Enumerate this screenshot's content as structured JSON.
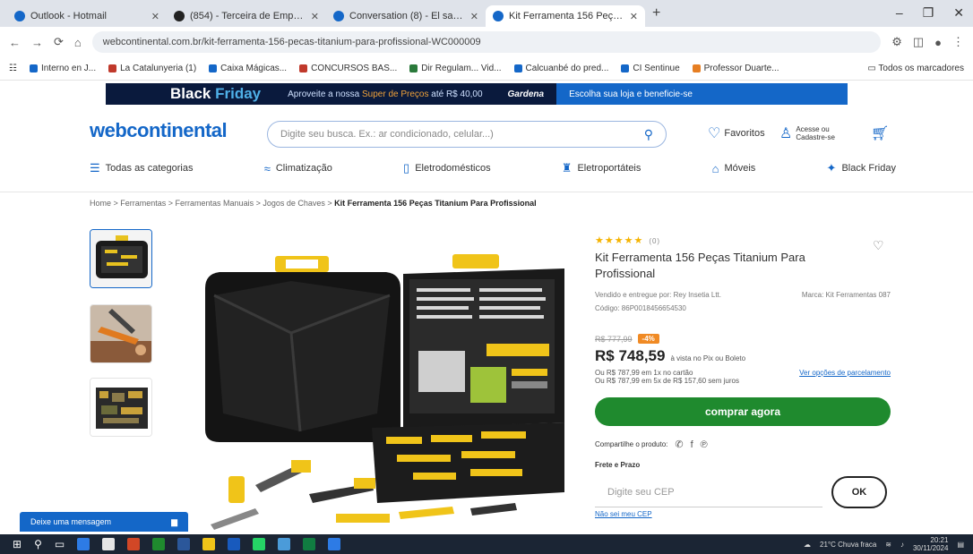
{
  "browser": {
    "tabs": [
      {
        "label": "Outlook - Hotmail",
        "color": "#1467c8"
      },
      {
        "label": "(854) - Terceira de Emprende...",
        "color": "#222"
      },
      {
        "label": "Conversation (8) - El sabiduría...",
        "color": "#1467c8"
      },
      {
        "label": "Kit Ferramenta 156 Peças Titan...",
        "color": "#1467c8",
        "active": true
      }
    ],
    "url": "webcontinental.com.br/kit-ferramenta-156-pecas-titanium-para-profissional-WC000009",
    "bookmarks": [
      {
        "label": "Interno en J...",
        "color": "#1467c8"
      },
      {
        "label": "La Catalunyeria (1)",
        "color": "#c0392b"
      },
      {
        "label": "Caixa Mágicas...",
        "color": "#1467c8"
      },
      {
        "label": "CONCURSOS BAS...",
        "color": "#c0392b"
      },
      {
        "label": "Dir Regulam... Vid...",
        "color": "#2a7a3b"
      },
      {
        "label": "Calcuanbé do pred...",
        "color": "#1467c8"
      },
      {
        "label": "CI Sentinue",
        "color": "#1467c8"
      },
      {
        "label": "Professor Duarte...",
        "color": "#e67e22"
      }
    ],
    "bookmark_folder": "Todos os marcadores"
  },
  "promo": {
    "bf_word1": "Black",
    "bf_word2": "Friday",
    "text1": "Aproveite a nossa",
    "text1_hl": "Super de Preços",
    "text2": "até R$ 40,00",
    "logo": "Gardena",
    "text3": "Escolha sua loja e beneficie-se"
  },
  "header": {
    "logo": "webcontinental",
    "search_placeholder": "Digite seu busca. Ex.: ar condicionado, celular...)",
    "wishlist": "Favoritos",
    "account": "Acesse ou Cadastre-se",
    "nav": [
      "Todas as categorias",
      "Climatização",
      "Eletrodomésticos",
      "Eletroportáteis",
      "Móveis",
      "Black Friday"
    ]
  },
  "breadcrumb": {
    "items": "Home  >  Ferramentas  >  Ferramentas Manuais  >  Jogos de Chaves  >",
    "current": "Kit Ferramenta 156 Peças Titanium Para Profissional"
  },
  "product": {
    "stars": "★★★★★",
    "reviews": "(0)",
    "title": "Kit Ferramenta 156 Peças Titanium Para Profissional",
    "seller": "Vendido e entregue por: Rey Insetia Ltt.",
    "brand": "Marca: Kit Ferramentas 087",
    "code": "Código: 86P0018456654530",
    "old_price": "R$ 777,99",
    "discount": "-4%",
    "price": "R$ 748,59",
    "pix": "à vista no Pix ou Boleto",
    "inst1": "Ou R$ 787,99 em 1x no cartão",
    "inst2": "Ou R$ 787,99 em 5x de R$ 157,60 sem juros",
    "inst_link": "Ver opções de parcelamento",
    "buy": "comprar agora",
    "share": "Compartilhe o produto:",
    "frete": "Frete e Prazo",
    "cep_placeholder": "Digite seu CEP",
    "ok": "OK",
    "cep_link": "Não sei meu CEP"
  },
  "chat": {
    "label": "Deixe uma mensagem"
  },
  "taskbar": {
    "weather": "21°C Chuva fraca",
    "time": "20:21",
    "date": "30/11/2024"
  }
}
